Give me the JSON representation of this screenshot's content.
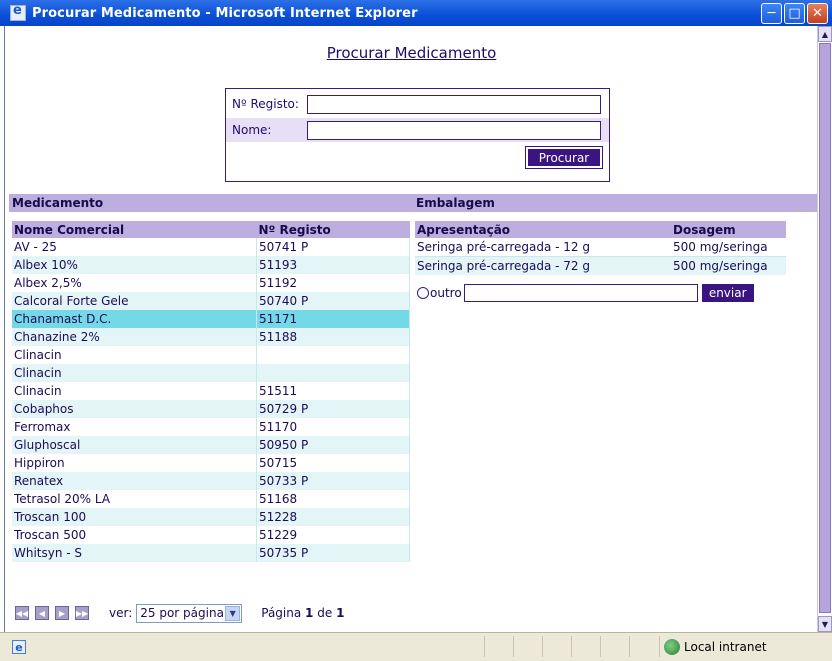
{
  "window": {
    "title": "Procurar Medicamento - Microsoft Internet Explorer"
  },
  "page": {
    "title": "Procurar Medicamento"
  },
  "search": {
    "registo_label": "Nº Registo:",
    "nome_label": "Nome:",
    "registo_value": "",
    "nome_value": "",
    "button_label": "Procurar"
  },
  "medicamento": {
    "section_title": "Medicamento",
    "headers": [
      "Nome Comercial",
      "Nº Registo"
    ],
    "rows": [
      [
        "AV - 25",
        "50741 P"
      ],
      [
        "Albex 10%",
        "51193"
      ],
      [
        "Albex 2,5%",
        "51192"
      ],
      [
        "Calcoral Forte Gele",
        "50740 P"
      ],
      [
        "Chanamast D.C.",
        "51171"
      ],
      [
        "Chanazine 2%",
        "51188"
      ],
      [
        "Clinacin",
        ""
      ],
      [
        "Clinacin",
        ""
      ],
      [
        "Clinacin",
        "51511"
      ],
      [
        "Cobaphos",
        "50729 P"
      ],
      [
        "Ferromax",
        "51170"
      ],
      [
        "Gluphoscal",
        "50950 P"
      ],
      [
        "Hippiron",
        "50715"
      ],
      [
        "Renatex",
        "50733 P"
      ],
      [
        "Tetrasol 20% LA",
        "51168"
      ],
      [
        "Troscan 100",
        "51228"
      ],
      [
        "Troscan 500",
        "51229"
      ],
      [
        "Whitsyn - S",
        "50735 P"
      ]
    ],
    "selected_index": 4
  },
  "embalagem": {
    "section_title": "Embalagem",
    "headers": [
      "Apresentação",
      "Dosagem"
    ],
    "rows": [
      [
        "Seringa pré-carregada - 12 g",
        "500 mg/seringa"
      ],
      [
        "Seringa pré-carregada - 72 g",
        "500 mg/seringa"
      ]
    ],
    "outro_label": "outro",
    "outro_value": "",
    "enviar_label": "enviar"
  },
  "pager": {
    "ver_label": "ver:",
    "per_page": "25 por página",
    "page_prefix": "Página",
    "current_page": "1",
    "page_sep": "de",
    "total_pages": "1"
  },
  "status": {
    "zone": "Local intranet"
  }
}
